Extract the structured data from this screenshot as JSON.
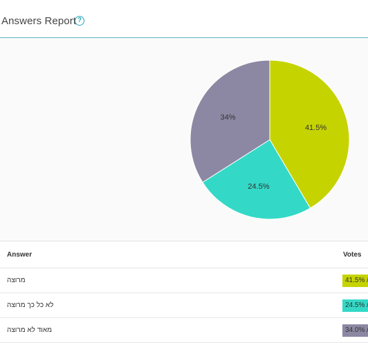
{
  "header": {
    "title": "Answers Report",
    "help_icon": "question-circle-icon"
  },
  "chart_data": {
    "type": "pie",
    "categories": [
      "מרוצה",
      "לא כל כך מרוצה",
      "מאוד לא מרוצה"
    ],
    "values": [
      41.5,
      24.5,
      34
    ],
    "labels": [
      "41.5%",
      "24.5%",
      "34%"
    ],
    "colors": [
      "#c5d300",
      "#33d9c6",
      "#8c88a3"
    ]
  },
  "table": {
    "headers": {
      "answer": "Answer",
      "votes": "Votes"
    },
    "rows": [
      {
        "answer": "מרוצה",
        "votes": "41.5% /"
      },
      {
        "answer": "לא כל כך מרוצה",
        "votes": "24.5% /"
      },
      {
        "answer": "מאוד לא מרוצה",
        "votes": "34.0% /"
      }
    ]
  }
}
